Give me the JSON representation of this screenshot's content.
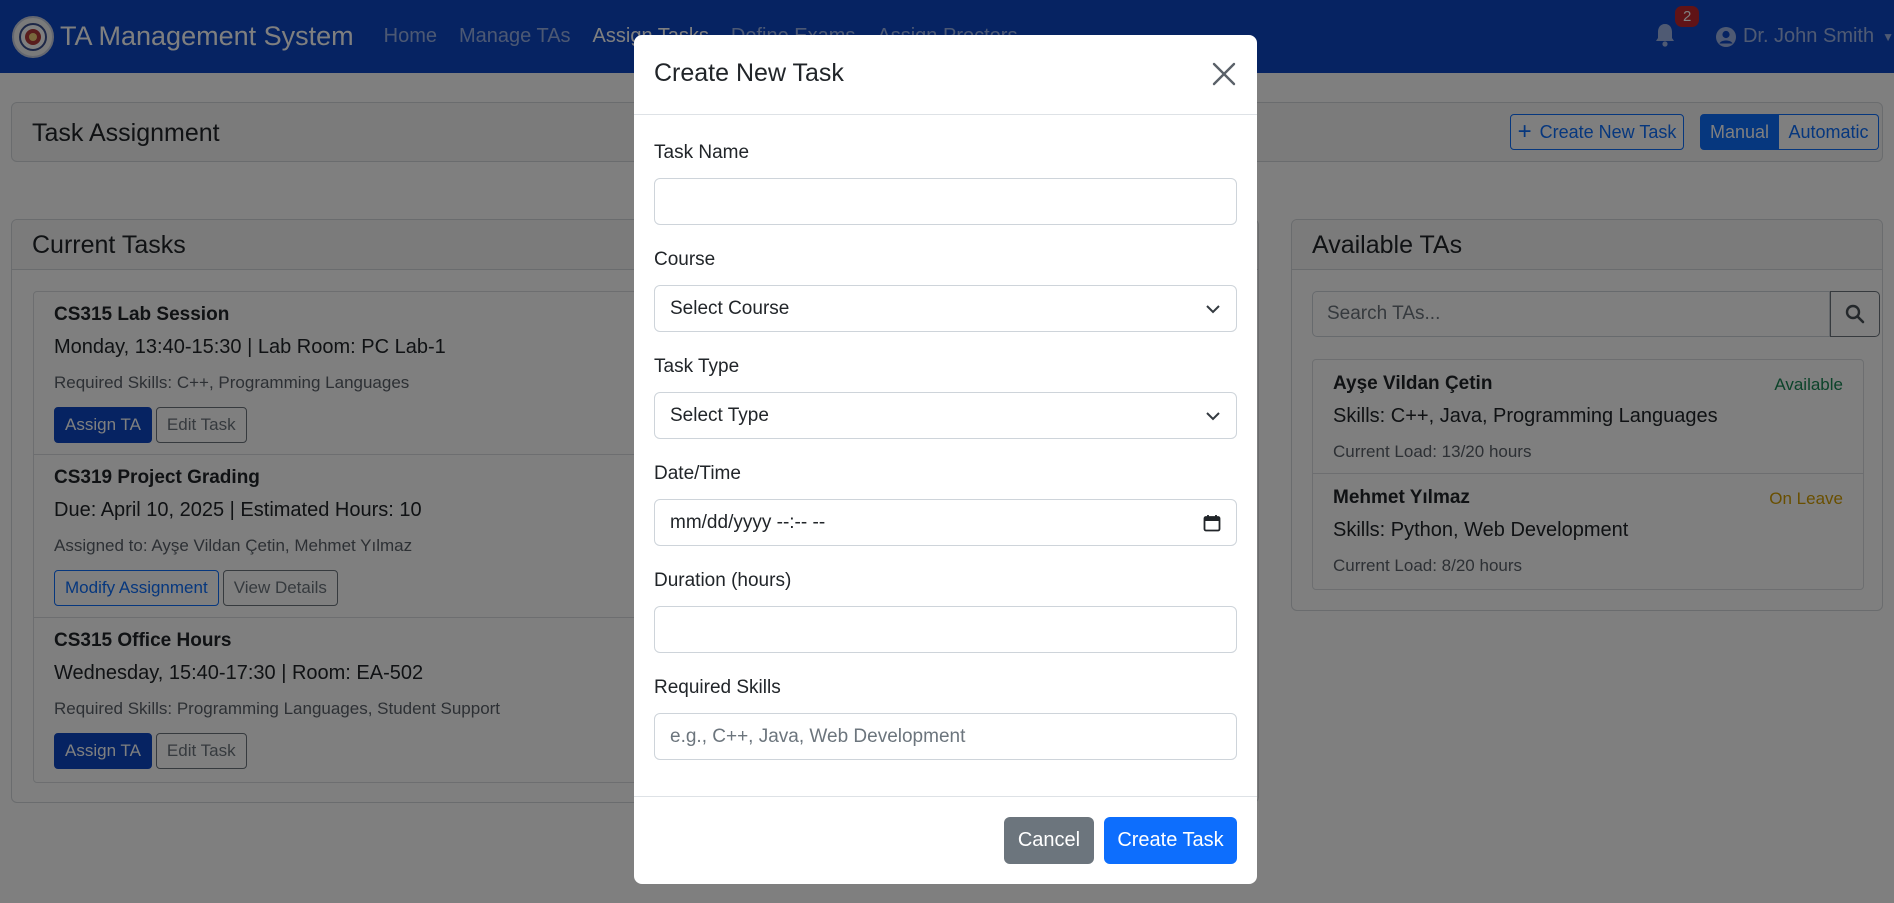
{
  "navbar": {
    "brand": "TA Management System",
    "links": [
      "Home",
      "Manage TAs",
      "Assign Tasks",
      "Define Exams",
      "Assign Proctors"
    ],
    "active_index": 2,
    "notification_count": "2",
    "user_name": "Dr. John Smith"
  },
  "header": {
    "title": "Task Assignment",
    "create_button": "Create New Task",
    "mode_manual": "Manual",
    "mode_automatic": "Automatic"
  },
  "current_tasks": {
    "heading": "Current Tasks",
    "items": [
      {
        "title": "CS315 Lab Session",
        "meta": "Monday, 13:40-15:30 | Lab Room: PC Lab-1",
        "detail": "Required Skills: C++, Programming Languages",
        "primary_action": "Assign TA",
        "secondary_action": "Edit Task"
      },
      {
        "title": "CS319 Project Grading",
        "meta": "Due: April 10, 2025 | Estimated Hours: 10",
        "detail": "Assigned to: Ayşe Vildan Çetin, Mehmet Yılmaz",
        "primary_action": "Modify Assignment",
        "secondary_action": "View Details"
      },
      {
        "title": "CS315 Office Hours",
        "meta": "Wednesday, 15:40-17:30 | Room: EA-502",
        "detail": "Required Skills: Programming Languages, Student Support",
        "primary_action": "Assign TA",
        "secondary_action": "Edit Task"
      }
    ]
  },
  "available_tas": {
    "heading": "Available TAs",
    "search_placeholder": "Search TAs...",
    "items": [
      {
        "name": "Ayşe Vildan Çetin",
        "status": "Available",
        "status_color": "#198754",
        "skills": "Skills: C++, Java, Programming Languages",
        "load": "Current Load: 13/20 hours"
      },
      {
        "name": "Mehmet Yılmaz",
        "status": "On Leave",
        "status_color": "#d39e00",
        "skills": "Skills: Python, Web Development",
        "load": "Current Load: 8/20 hours"
      }
    ]
  },
  "modal": {
    "title": "Create New Task",
    "fields": {
      "task_name": {
        "label": "Task Name",
        "value": ""
      },
      "course": {
        "label": "Course",
        "value": "Select Course"
      },
      "task_type": {
        "label": "Task Type",
        "value": "Select Type"
      },
      "datetime": {
        "label": "Date/Time",
        "value": "mm/dd/yyyy --:-- --"
      },
      "duration": {
        "label": "Duration (hours)",
        "value": ""
      },
      "skills": {
        "label": "Required Skills",
        "placeholder": "e.g., C++, Java, Web Development"
      }
    },
    "cancel": "Cancel",
    "submit": "Create Task"
  },
  "colors": {
    "navbar": "#0d47c4",
    "primary": "#0d6efd",
    "secondary": "#6c757d"
  }
}
